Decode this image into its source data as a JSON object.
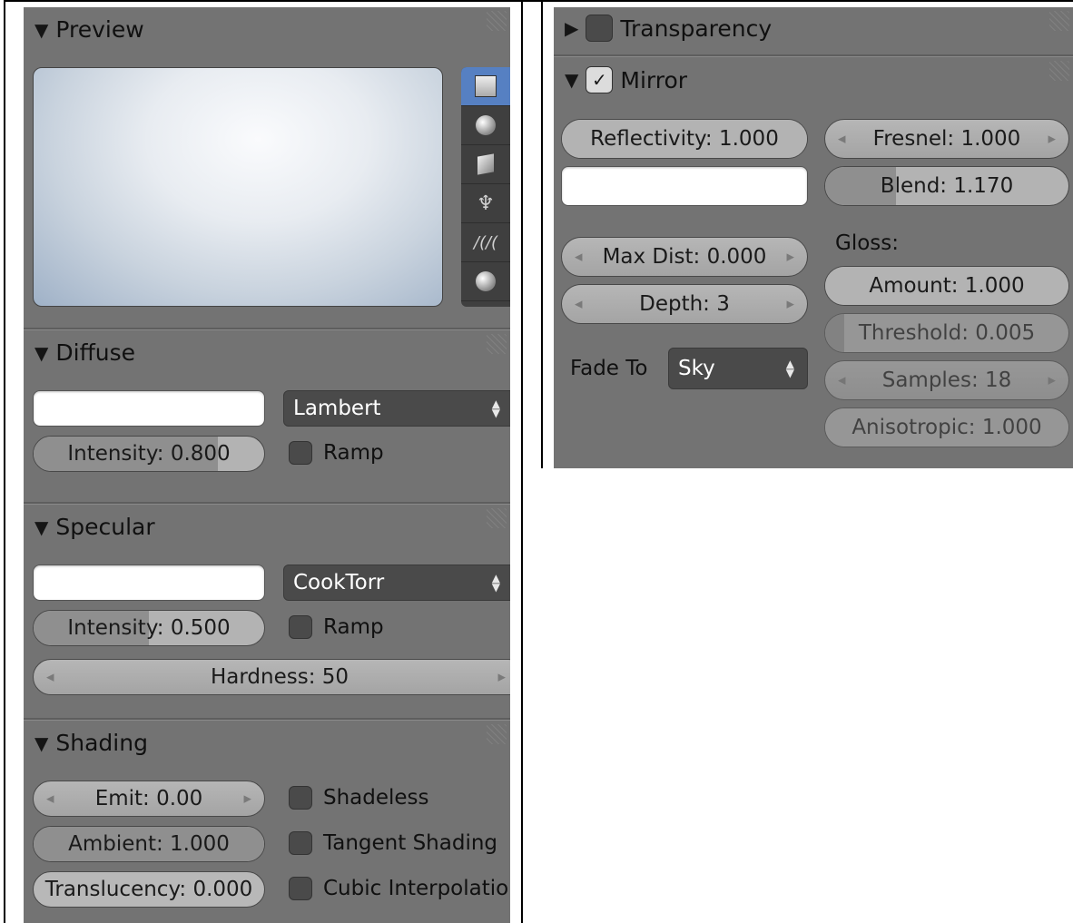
{
  "left": {
    "preview": {
      "title": "Preview",
      "tools": [
        "plane-icon",
        "sphere-icon",
        "cube-icon",
        "monkey-icon",
        "hair-icon",
        "sphere-sky-icon"
      ],
      "hair_glyph": "/(/("
    },
    "diffuse": {
      "title": "Diffuse",
      "shader": "Lambert",
      "intensity_label": "Intensity: 0.800",
      "intensity_value": 0.8,
      "ramp_label": "Ramp"
    },
    "specular": {
      "title": "Specular",
      "shader": "CookTorr",
      "intensity_label": "Intensity: 0.500",
      "intensity_value": 0.5,
      "ramp_label": "Ramp",
      "hardness_label": "Hardness: 50"
    },
    "shading": {
      "title": "Shading",
      "emit_label": "Emit: 0.00",
      "ambient_label": "Ambient: 1.000",
      "ambient_value": 1.0,
      "translucency_label": "Translucency: 0.000",
      "translucency_value": 0.0,
      "shadeless_label": "Shadeless",
      "tangent_label": "Tangent Shading",
      "cubic_label": "Cubic Interpolation"
    }
  },
  "right": {
    "transparency": {
      "title": "Transparency",
      "checked": false
    },
    "mirror": {
      "title": "Mirror",
      "checked": true,
      "reflectivity_label": "Reflectivity: 1.000",
      "reflectivity_value": 1.0,
      "fresnel_label": "Fresnel: 1.000",
      "blend_label": "Blend: 1.170",
      "blend_value": 0.29,
      "max_dist_label": "Max Dist: 0.000",
      "depth_label": "Depth: 3",
      "fade_to_label": "Fade To",
      "fade_to_value": "Sky",
      "gloss_label": "Gloss:",
      "amount_label": "Amount: 1.000",
      "amount_value": 1.0,
      "threshold_label": "Threshold: 0.005",
      "threshold_value": 0.005,
      "samples_label": "Samples: 18",
      "anisotropic_label": "Anisotropic: 1.000",
      "anisotropic_value": 1.0
    }
  },
  "colors": {
    "panel_bg": "#737373",
    "slider_bg": "#b3b3b3",
    "slider_fill": "#8f8f8f",
    "dropdown_bg": "#4a4a4a",
    "active_tool": "#5680c2"
  }
}
